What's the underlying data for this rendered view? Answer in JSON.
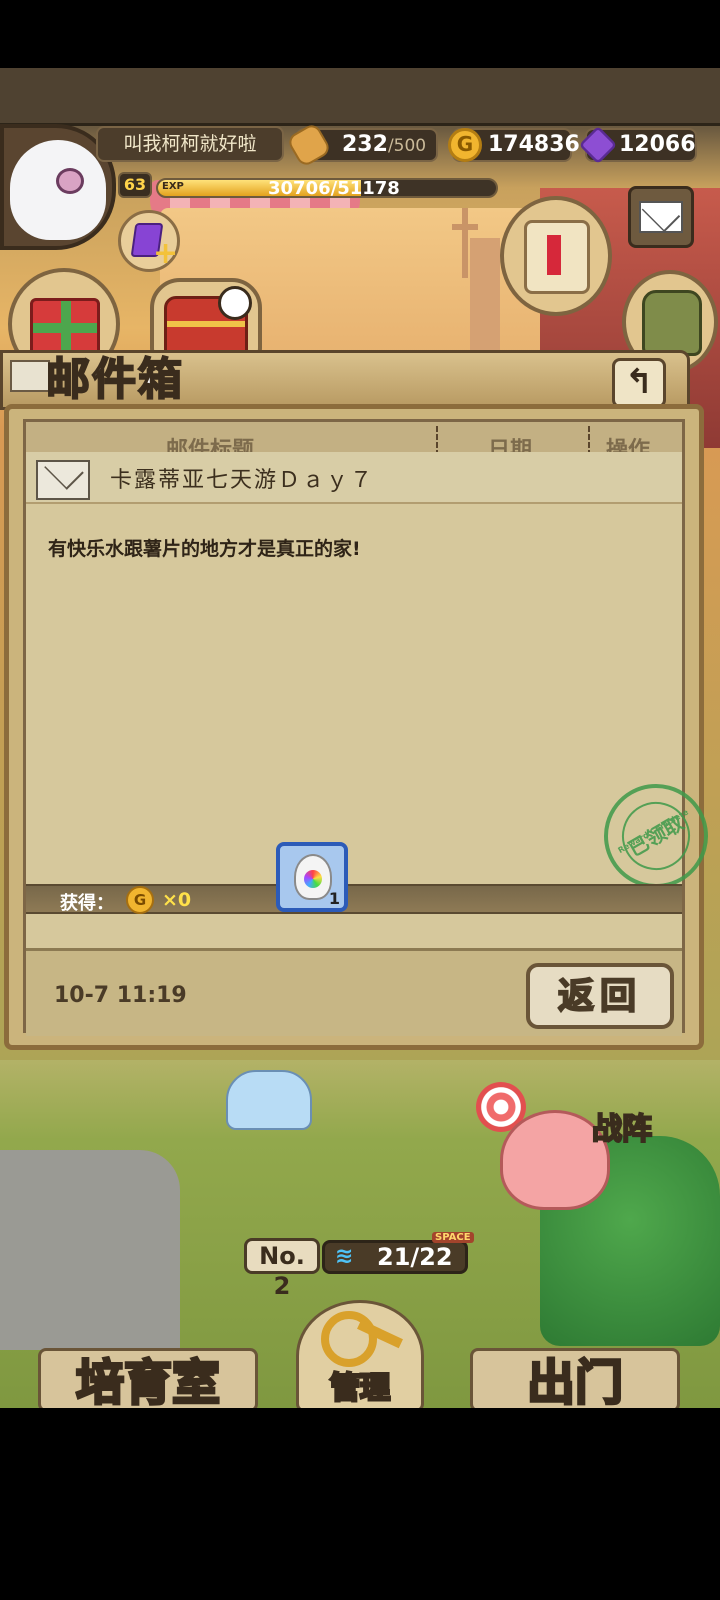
{
  "header": {
    "player_name": "叫我柯柯就好啦",
    "level": "63",
    "exp_tag": "EXP",
    "exp_text": "30706/51178",
    "exp_fraction": 0.6,
    "stamina_value": "232",
    "stamina_max": "/500",
    "gold": "174836",
    "gold_icon_letter": "G",
    "gems": "12066",
    "gem_plus": "+"
  },
  "mailbox": {
    "title": "邮件箱",
    "back_icon": "↰",
    "columns": {
      "subject": "邮件标题",
      "date": "日期",
      "action": "操作"
    },
    "subject": "卡露蒂亚七天游Ｄａｙ７",
    "body": "有快乐水跟薯片的地方才是真正的家!",
    "stamp_text": "已领取",
    "stamp_ring": "Reward Complete",
    "reward_label": "获得：",
    "coin_letter": "G",
    "coin_count": "×0",
    "item_qty": "1",
    "date": "10-7 11:19",
    "return_label": "返回"
  },
  "bottom": {
    "team_label": "战阵",
    "no_label": "No. 2",
    "space_tag": "SPACE",
    "space_icon": "≋",
    "space_value": "21/22",
    "nav_left": "培育室",
    "nav_mid": "管理",
    "nav_right": "出门"
  },
  "colors": {
    "panel_bg": "#d6c89c",
    "panel_border": "#8c6c3c",
    "stamp_green": "#3f9a4a",
    "gold_yellow": "#f1b52f",
    "gem_purple": "#8d4ed3"
  }
}
